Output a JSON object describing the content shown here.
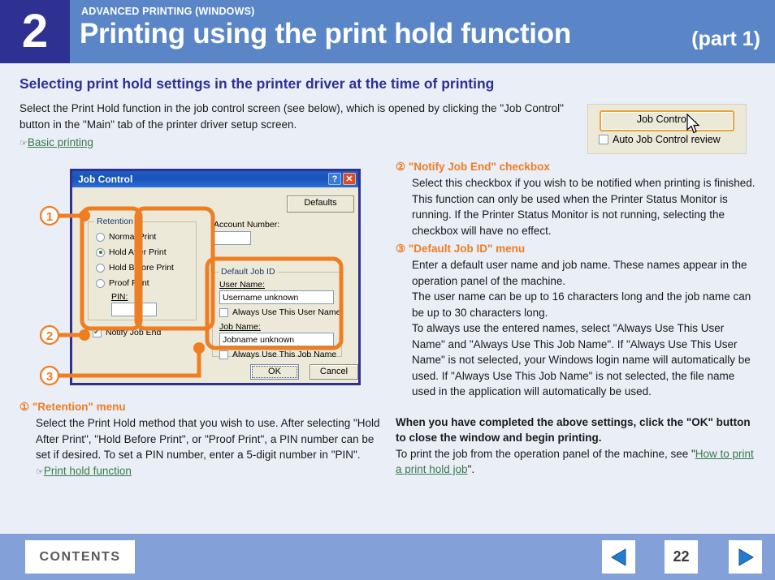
{
  "header": {
    "chapter": "2",
    "kicker": "ADVANCED PRINTING (WINDOWS)",
    "title": "Printing using the print hold function",
    "part": "(part 1)"
  },
  "section_heading": "Selecting print hold settings in the printer driver at the time of printing",
  "intro": {
    "paragraph": "Select the Print Hold function in the job control screen (see below), which is opened by clicking the \"Job Control\" button in the \"Main\" tab of the printer driver setup screen.",
    "link": "Basic printing",
    "hand_icon": "pointing-hand-icon"
  },
  "job_control_snippet": {
    "button_label": "Job Control...",
    "checkbox_label": "Auto Job Control review",
    "checkbox_checked": false,
    "cursor": "mouse-pointer-icon",
    "accent_color": "#e8a33d"
  },
  "dialog": {
    "title": "Job Control",
    "help_button": "?",
    "close_button": "✕",
    "defaults_button": "Defaults",
    "retention": {
      "group_title": "Retention",
      "options": [
        {
          "label": "Normal Print",
          "selected": false
        },
        {
          "label": "Hold After Print",
          "selected": true
        },
        {
          "label": "Hold Before Print",
          "selected": false
        },
        {
          "label": "Proof Print",
          "selected": false
        }
      ],
      "pin_label": "PIN:",
      "pin_value": ""
    },
    "notify_job_end": {
      "label": "Notify Job End",
      "checked": true
    },
    "account_number": {
      "label": "Account Number:",
      "value": ""
    },
    "default_job_id": {
      "group_title": "Default Job ID",
      "user_name_label": "User Name:",
      "user_name_value": "Username unknown",
      "always_user_label": "Always Use This User Name",
      "always_user_checked": false,
      "job_name_label": "Job Name:",
      "job_name_value": "Jobname unknown",
      "always_job_label": "Always Use This Job Name",
      "always_job_checked": false
    },
    "ok_button": "OK",
    "cancel_button": "Cancel"
  },
  "callouts": {
    "one": "①",
    "two": "②",
    "three": "③",
    "color": "#ef7d22"
  },
  "items": {
    "item1": {
      "heading": "① \"Retention\" menu",
      "body": "Select the Print Hold method that you wish to use. After selecting \"Hold After Print\", \"Hold Before Print\", or \"Proof Print\", a PIN number can be set if desired. To set a PIN number, enter a 5-digit number in \"PIN\".",
      "link": "Print hold function"
    },
    "item2": {
      "heading": "② \"Notify Job End\" checkbox",
      "body_1": "Select this checkbox if you wish to be notified when printing is finished.",
      "body_2": "This function can only be used when the Printer Status Monitor is running. If the Printer Status Monitor is not running, selecting the checkbox will have no effect."
    },
    "item3": {
      "heading": "③ \"Default Job ID\" menu",
      "body_1": "Enter a default user name and job name. These names appear in the operation panel of the machine.",
      "body_2": "The user name can be up to 16 characters long and the job name can be up to 30 characters long.",
      "body_3": "To always use the entered names, select \"Always Use This User Name\" and \"Always Use This Job Name\". If \"Always Use This User Name\" is not selected, your Windows login name will automatically be used. If \"Always Use This Job Name\" is not selected, the file name used in the application will automatically be used."
    }
  },
  "closing": {
    "bold": "When you have completed the above settings, click the \"OK\" button to close the window and begin printing.",
    "text_before": "To print the job from the operation panel of the machine, see \"",
    "link": "How to print a print hold job",
    "text_after": "\"."
  },
  "footer": {
    "contents_label": "CONTENTS",
    "page_number": "22",
    "prev_icon": "triangle-left-icon",
    "next_icon": "triangle-right-icon"
  }
}
